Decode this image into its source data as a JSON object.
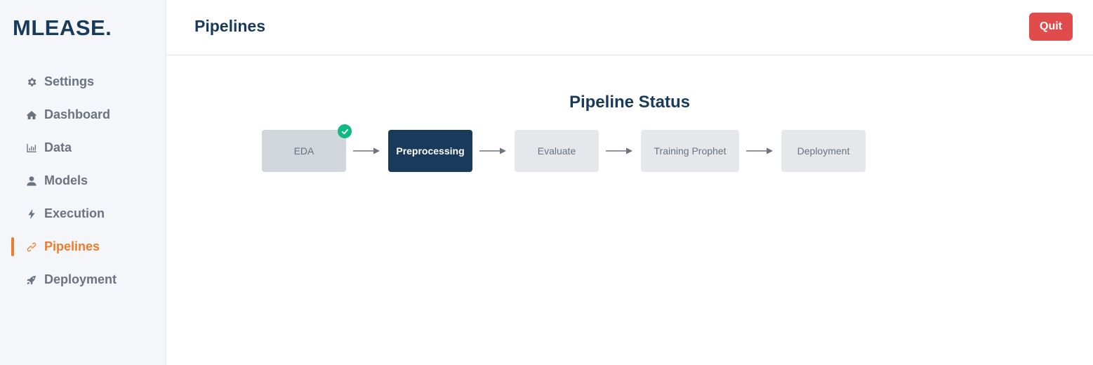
{
  "app": {
    "logo": "MLEASE."
  },
  "sidebar": {
    "items": [
      {
        "label": "Settings",
        "icon": "gear-icon"
      },
      {
        "label": "Dashboard",
        "icon": "home-icon"
      },
      {
        "label": "Data",
        "icon": "bar-chart-icon"
      },
      {
        "label": "Models",
        "icon": "user-icon"
      },
      {
        "label": "Execution",
        "icon": "bolt-icon"
      },
      {
        "label": "Pipelines",
        "icon": "link-icon",
        "active": true
      },
      {
        "label": "Deployment",
        "icon": "rocket-icon"
      }
    ]
  },
  "header": {
    "title": "Pipelines",
    "quit_label": "Quit"
  },
  "pipeline": {
    "title": "Pipeline Status",
    "steps": [
      {
        "label": "EDA",
        "status": "completed"
      },
      {
        "label": "Preprocessing",
        "status": "current"
      },
      {
        "label": "Evaluate",
        "status": "pending"
      },
      {
        "label": "Training Prophet",
        "status": "pending"
      },
      {
        "label": "Deployment",
        "status": "pending"
      }
    ]
  },
  "colors": {
    "accent": "#f07b2a",
    "primary": "#1a3a5c",
    "danger": "#e04b4b",
    "success": "#10b981"
  }
}
